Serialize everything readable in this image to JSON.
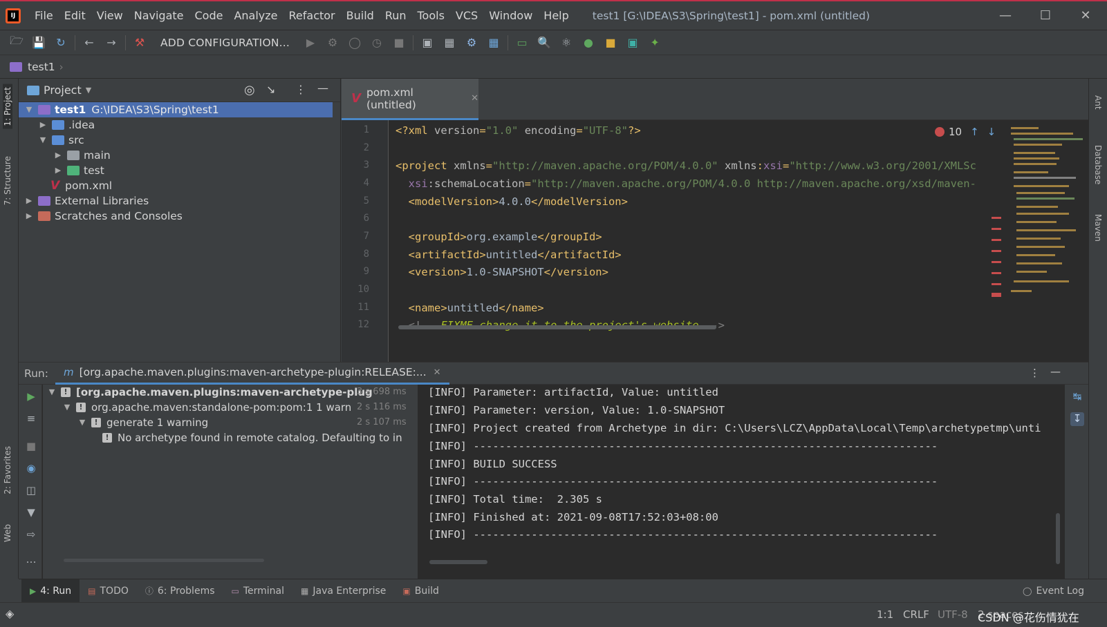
{
  "menubar": {
    "items": [
      "File",
      "Edit",
      "View",
      "Navigate",
      "Code",
      "Analyze",
      "Refactor",
      "Build",
      "Run",
      "Tools",
      "VCS",
      "Window",
      "Help"
    ],
    "window_title": "test1 [G:\\IDEA\\S3\\Spring\\test1] - pom.xml (untitled)"
  },
  "toolbar": {
    "add_configuration": "ADD CONFIGURATION..."
  },
  "navbar": {
    "project": "test1"
  },
  "left_stripe": {
    "project": "1: Project",
    "structure": "7: Structure",
    "favorites": "2: Favorites",
    "web": "Web"
  },
  "right_stripe": {
    "ant": "Ant",
    "database": "Database",
    "maven": "Maven"
  },
  "project_panel": {
    "title": "Project",
    "root_name": "test1",
    "root_path": "G:\\IDEA\\S3\\Spring\\test1",
    "items": [
      ".idea",
      "src",
      "main",
      "test",
      "pom.xml",
      "External Libraries",
      "Scratches and Consoles"
    ]
  },
  "editor": {
    "tab_label": "pom.xml (untitled)",
    "error_count": "10",
    "line_numbers": [
      "1",
      "2",
      "3",
      "4",
      "5",
      "6",
      "7",
      "8",
      "9",
      "10",
      "11",
      "12"
    ]
  },
  "run_panel": {
    "label": "Run:",
    "tab_label": "[org.apache.maven.plugins:maven-archetype-plugin:RELEASE:...",
    "tree": [
      {
        "label": "[org.apache.maven.plugins:maven-archetype-plug",
        "time": "3 s 698 ms"
      },
      {
        "label": "org.apache.maven:standalone-pom:pom:1  1 warn",
        "time": "2 s 116 ms"
      },
      {
        "label": "generate  1 warning",
        "time": "2 s 107 ms"
      },
      {
        "label": "No archetype found in remote catalog. Defaulting to in",
        "time": ""
      }
    ],
    "console": [
      "[INFO] Parameter: artifactId, Value: untitled",
      "[INFO] Parameter: version, Value: 1.0-SNAPSHOT",
      "[INFO] Project created from Archetype in dir: C:\\Users\\LCZ\\AppData\\Local\\Temp\\archetypetmp\\unti",
      "[INFO] ------------------------------------------------------------------------",
      "[INFO] BUILD SUCCESS",
      "[INFO] ------------------------------------------------------------------------",
      "[INFO] Total time:  2.305 s",
      "[INFO] Finished at: 2021-09-08T17:52:03+08:00",
      "[INFO] ------------------------------------------------------------------------"
    ]
  },
  "bottom_tabs": {
    "run": "4: Run",
    "todo": "TODO",
    "problems": "6: Problems",
    "terminal": "Terminal",
    "java_enterprise": "Java Enterprise",
    "build": "Build",
    "event_log": "Event Log"
  },
  "status_bar": {
    "position": "1:1",
    "line_sep": "CRLF",
    "encoding": "UTF-8",
    "indent": "2 spaces",
    "watermark": "CSDN @花伤情犹在"
  },
  "colors": {
    "accent": "#4a88c7",
    "maven": "#c0304a",
    "bg_editor": "#2b2b2b",
    "bg_panel": "#3c3f41"
  }
}
